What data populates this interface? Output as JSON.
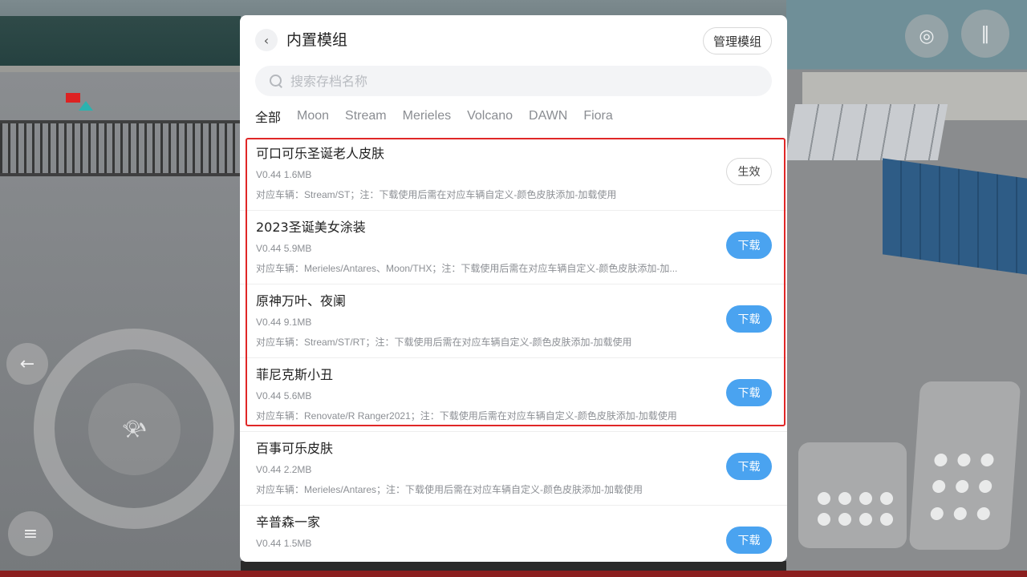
{
  "header": {
    "back_icon": "chevron-left-icon",
    "title": "内置模组",
    "manage_label": "管理模组"
  },
  "search": {
    "placeholder": "搜索存档名称",
    "value": ""
  },
  "tabs": [
    {
      "label": "全部",
      "active": true
    },
    {
      "label": "Moon",
      "active": false
    },
    {
      "label": "Stream",
      "active": false
    },
    {
      "label": "Merieles",
      "active": false
    },
    {
      "label": "Volcano",
      "active": false
    },
    {
      "label": "DAWN",
      "active": false
    },
    {
      "label": "Fiora",
      "active": false
    }
  ],
  "mods": [
    {
      "name": "可口可乐圣诞老人皮肤",
      "meta": "V0.44  1.6MB",
      "desc": "对应车辆：Stream/ST；注：下载使用后需在对应车辆自定义-颜色皮肤添加-加载使用",
      "action": "生效",
      "action_type": "active"
    },
    {
      "name": "2023圣诞美女涂装",
      "meta": "V0.44  5.9MB",
      "desc": "对应车辆：Merieles/Antares、Moon/THX；注：下载使用后需在对应车辆自定义-颜色皮肤添加-加...",
      "action": "下载",
      "action_type": "download"
    },
    {
      "name": "原神万叶、夜阑",
      "meta": "V0.44  9.1MB",
      "desc": "对应车辆：Stream/ST/RT；注：下载使用后需在对应车辆自定义-颜色皮肤添加-加载使用",
      "action": "下载",
      "action_type": "download"
    },
    {
      "name": "菲尼克斯小丑",
      "meta": "V0.44  5.6MB",
      "desc": "对应车辆：Renovate/R Ranger2021；注：下载使用后需在对应车辆自定义-颜色皮肤添加-加载使用",
      "action": "下载",
      "action_type": "download"
    },
    {
      "name": "百事可乐皮肤",
      "meta": "V0.44  2.2MB",
      "desc": "对应车辆：Merieles/Antares；注：下载使用后需在对应车辆自定义-颜色皮肤添加-加载使用",
      "action": "下载",
      "action_type": "download"
    },
    {
      "name": "辛普森一家",
      "meta": "V0.44  1.5MB",
      "desc": "",
      "action": "下载",
      "action_type": "download"
    }
  ],
  "colors": {
    "accent": "#4aa3f0",
    "highlight": "#e02727"
  },
  "hud": {
    "wheel_icon": "steering-wheel-icon",
    "horn_icon": "horn-icon",
    "back_icon": "arrow-left-icon",
    "light_icon": "headlight-icon",
    "camera_icon": "camera-icon",
    "pause_icon": "pause-icon",
    "brake_icon": "brake-pedal-icon",
    "gas_icon": "gas-pedal-icon"
  }
}
